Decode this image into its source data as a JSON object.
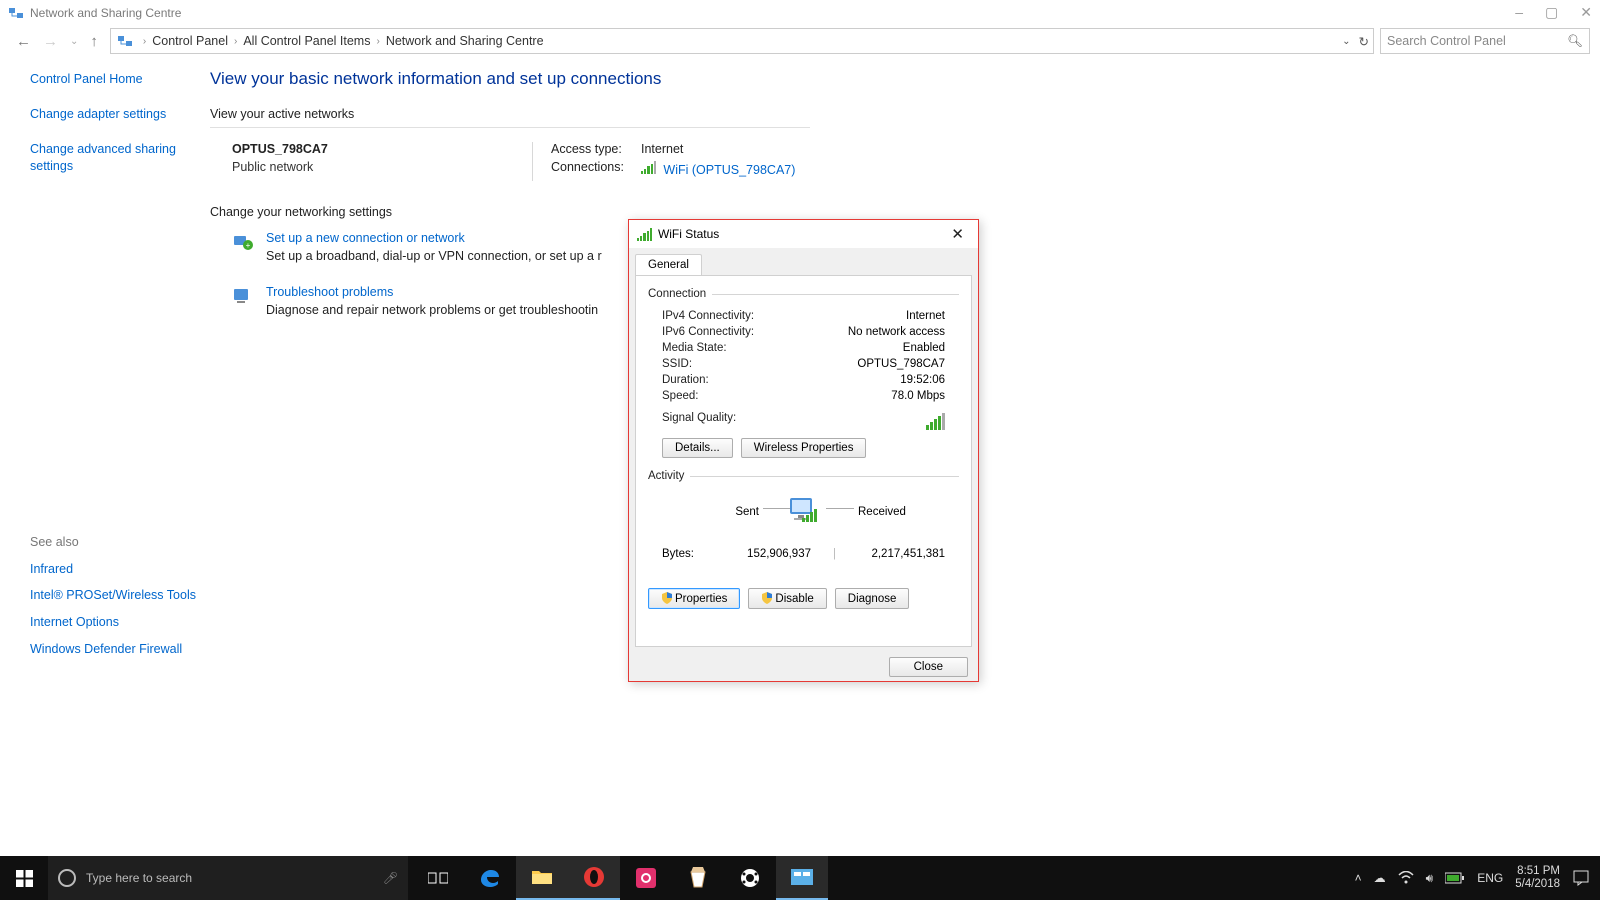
{
  "window": {
    "title": "Network and Sharing Centre"
  },
  "wincontrols": {
    "min": "–",
    "max": "▢",
    "close": "✕"
  },
  "breadcrumb": {
    "items": [
      "Control Panel",
      "All Control Panel Items",
      "Network and Sharing Centre"
    ],
    "refresh_tip": "Refresh"
  },
  "search": {
    "placeholder": "Search Control Panel"
  },
  "sidebar": {
    "links": [
      "Control Panel Home",
      "Change adapter settings",
      "Change advanced sharing settings"
    ],
    "seealso_label": "See also",
    "seealso": [
      "Infrared",
      "Intel® PROSet/Wireless Tools",
      "Internet Options",
      "Windows Defender Firewall"
    ]
  },
  "content": {
    "heading": "View your basic network information and set up connections",
    "active_label": "View your active networks",
    "network": {
      "name": "OPTUS_798CA7",
      "type": "Public network",
      "access_label": "Access type:",
      "access_value": "Internet",
      "conn_label": "Connections:",
      "conn_link": "WiFi (OPTUS_798CA7)"
    },
    "change_label": "Change your networking settings",
    "setup": {
      "title": "Set up a new connection or network",
      "desc": "Set up a broadband, dial-up or VPN connection, or set up a r"
    },
    "trouble": {
      "title": "Troubleshoot problems",
      "desc": "Diagnose and repair network problems or get troubleshootin"
    }
  },
  "dialog": {
    "title": "WiFi Status",
    "tab": "General",
    "group_connection": "Connection",
    "conn": {
      "ipv4_k": "IPv4 Connectivity:",
      "ipv4_v": "Internet",
      "ipv6_k": "IPv6 Connectivity:",
      "ipv6_v": "No network access",
      "media_k": "Media State:",
      "media_v": "Enabled",
      "ssid_k": "SSID:",
      "ssid_v": "OPTUS_798CA7",
      "dur_k": "Duration:",
      "dur_v": "19:52:06",
      "speed_k": "Speed:",
      "speed_v": "78.0 Mbps",
      "sig_k": "Signal Quality:"
    },
    "details_btn": "Details...",
    "wireless_btn": "Wireless Properties",
    "group_activity": "Activity",
    "sent_label": "Sent",
    "recv_label": "Received",
    "bytes_label": "Bytes:",
    "bytes_sent": "152,906,937",
    "bytes_recv": "2,217,451,381",
    "properties_btn": "Properties",
    "disable_btn": "Disable",
    "diagnose_btn": "Diagnose",
    "close_btn": "Close"
  },
  "taskbar": {
    "search_placeholder": "Type here to search",
    "lang": "ENG",
    "time": "8:51 PM",
    "date": "5/4/2018"
  }
}
